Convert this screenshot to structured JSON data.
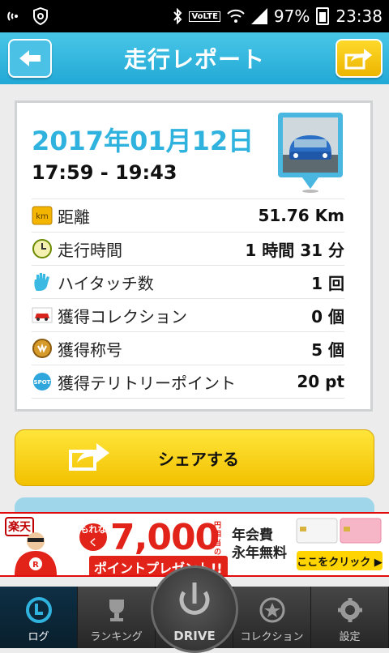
{
  "status_bar": {
    "battery": "97%",
    "time": "23:38",
    "network": "VoLTE"
  },
  "header": {
    "title": "走行レポート"
  },
  "report": {
    "date": "2017年01月12日",
    "time_range": "17:59 - 19:43",
    "rows": [
      {
        "icon": "km-icon",
        "label": "距離",
        "value": "51.76 Km"
      },
      {
        "icon": "clock-icon",
        "label": "走行時間",
        "value": "1 時間 31 分"
      },
      {
        "icon": "hand-icon",
        "label": "ハイタッチ数",
        "value": "1 回"
      },
      {
        "icon": "car-icon",
        "label": "獲得コレクション",
        "value": "0 個"
      },
      {
        "icon": "medal-icon",
        "label": "獲得称号",
        "value": "5 個"
      },
      {
        "icon": "spot-icon",
        "label": "獲得テリトリーポイント",
        "value": "20 pt"
      }
    ]
  },
  "share": {
    "label": "シェアする"
  },
  "ad": {
    "brand": "楽天",
    "circle_text": "もれなく",
    "points": "7,000",
    "yen": "円相当の",
    "present": "ポイントプレゼント!!",
    "fee_line1": "年会費",
    "fee_line2": "永年無料",
    "click": "ここをクリック ▶"
  },
  "tabbar": {
    "tabs": [
      {
        "label": "ログ",
        "icon": "log-icon",
        "active": true
      },
      {
        "label": "ランキング",
        "icon": "trophy-icon",
        "active": false
      },
      {
        "label": "DRIVE",
        "icon": "power-icon",
        "active": false
      },
      {
        "label": "コレクション",
        "icon": "star-icon",
        "active": false
      },
      {
        "label": "設定",
        "icon": "gear-icon",
        "active": false
      }
    ]
  },
  "colors": {
    "header": "#2bb0dc",
    "accent_blue": "#2fb3de",
    "share_yellow": "#f5c800"
  }
}
